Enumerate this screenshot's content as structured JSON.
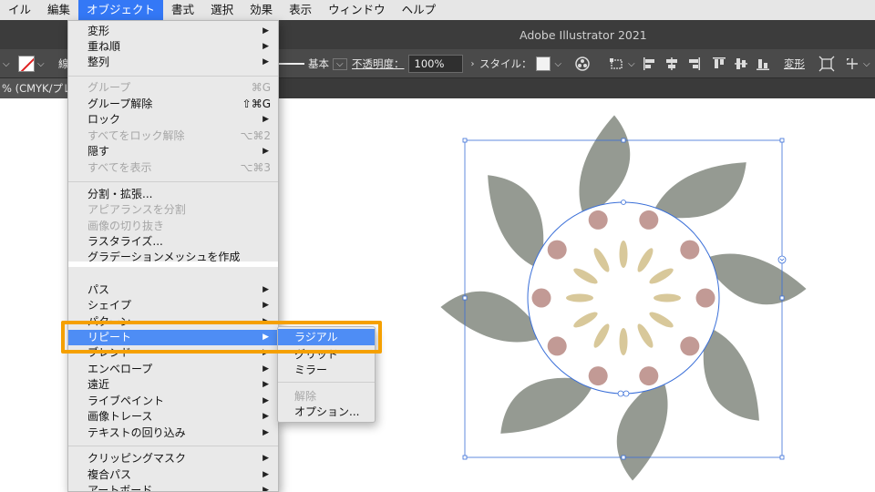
{
  "menubar": {
    "items": [
      "イル",
      "編集",
      "オブジェクト",
      "書式",
      "選択",
      "効果",
      "表示",
      "ウィンドウ",
      "ヘルプ"
    ],
    "active_index": 2
  },
  "window": {
    "title": "Adobe Illustrator 2021"
  },
  "controlbar": {
    "stroke_label": "線",
    "stroke_profile": "基本",
    "opacity_label": "不透明度：",
    "opacity_value": "100%",
    "style_label": "スタイル：",
    "transform_label": "変形"
  },
  "tab": {
    "label": "% (CMYK/プレビュ"
  },
  "object_menu": {
    "items": [
      {
        "label": "変形",
        "submenu": true,
        "enabled": true
      },
      {
        "label": "重ね順",
        "submenu": true,
        "enabled": true
      },
      {
        "label": "整列",
        "submenu": true,
        "enabled": true
      },
      {
        "label": "グループ",
        "shortcut": "⌘G",
        "enabled": false
      },
      {
        "label": "グループ解除",
        "shortcut": "⇧⌘G",
        "enabled": true
      },
      {
        "label": "ロック",
        "submenu": true,
        "enabled": true
      },
      {
        "label": "すべてをロック解除",
        "shortcut": "⌥⌘2",
        "enabled": false
      },
      {
        "label": "隠す",
        "submenu": true,
        "enabled": true
      },
      {
        "label": "すべてを表示",
        "shortcut": "⌥⌘3",
        "enabled": false
      },
      {
        "label": "分割・拡張...",
        "enabled": true
      },
      {
        "label": "アピアランスを分割",
        "enabled": false
      },
      {
        "label": "画像の切り抜き",
        "enabled": false
      },
      {
        "label": "ラスタライズ...",
        "enabled": true
      },
      {
        "label": "グラデーションメッシュを作成",
        "enabled": true
      },
      {
        "label": "パス",
        "submenu": true,
        "enabled": true
      },
      {
        "label": "シェイプ",
        "submenu": true,
        "enabled": true
      },
      {
        "label": "パターン",
        "submenu": true,
        "enabled": true
      },
      {
        "label": "リピート",
        "submenu": true,
        "enabled": true,
        "highlighted": true
      },
      {
        "label": "ブレンド",
        "submenu": true,
        "enabled": true
      },
      {
        "label": "エンベロープ",
        "submenu": true,
        "enabled": true
      },
      {
        "label": "遠近",
        "submenu": true,
        "enabled": true
      },
      {
        "label": "ライブペイント",
        "submenu": true,
        "enabled": true
      },
      {
        "label": "画像トレース",
        "submenu": true,
        "enabled": true
      },
      {
        "label": "テキストの回り込み",
        "submenu": true,
        "enabled": true
      },
      {
        "label": "クリッピングマスク",
        "submenu": true,
        "enabled": true
      },
      {
        "label": "複合パス",
        "submenu": true,
        "enabled": true
      },
      {
        "label": "アートボード",
        "submenu": true,
        "enabled": true
      }
    ]
  },
  "repeat_submenu": {
    "items": [
      {
        "label": "ラジアル",
        "highlighted": true,
        "enabled": true
      },
      {
        "label": "グリッド",
        "enabled": true
      },
      {
        "label": "ミラー",
        "enabled": true
      },
      {
        "label": "解除",
        "enabled": false
      },
      {
        "label": "オプション...",
        "enabled": true
      }
    ]
  },
  "artwork": {
    "leaf_color": "#959a92",
    "dot_color": "#c29a95",
    "petal_color": "#d8c89a",
    "selection_color": "#3a6fd8",
    "leaf_count": 8,
    "dot_count": 10,
    "petal_count": 12
  },
  "colors": {
    "menu_highlight": "#4e8df5",
    "callout": "#f5a000"
  }
}
